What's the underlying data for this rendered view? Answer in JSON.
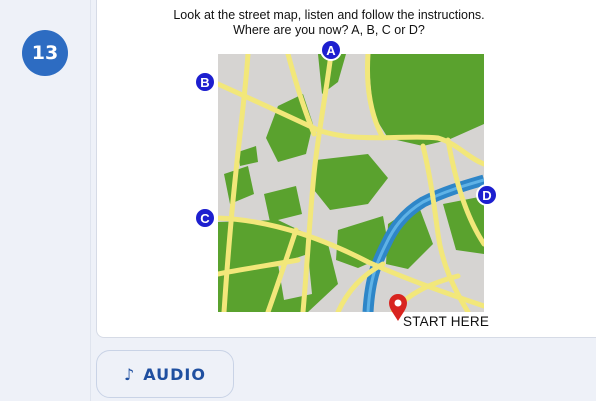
{
  "question": {
    "number": "13",
    "instruction_line1": "Look at the street map, listen and follow the instructions.",
    "instruction_line2": "Where are you now? A, B, C or D?"
  },
  "map": {
    "markers": [
      {
        "label": "A"
      },
      {
        "label": "B"
      },
      {
        "label": "C"
      },
      {
        "label": "D"
      }
    ],
    "start_label": "START HERE",
    "colors": {
      "ground": "#d6d4d2",
      "park": "#5aa22e",
      "road": "#f2e77a",
      "river": "#2e86c8",
      "marker": "#1d1fcf",
      "pin": "#d8241f"
    }
  },
  "audio_button": {
    "icon": "music-note-icon",
    "label": "AUDIO"
  }
}
